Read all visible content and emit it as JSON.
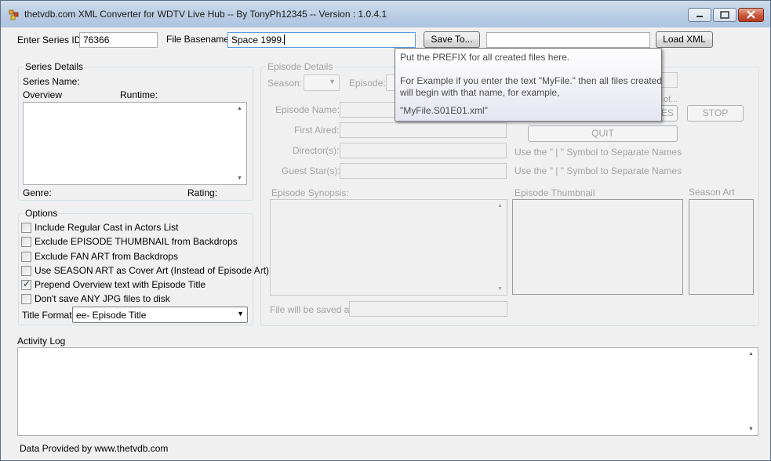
{
  "window": {
    "title": "thetvdb.com XML Converter for WDTV Live Hub -- By TonyPh12345 -- Version : 1.0.4.1"
  },
  "top": {
    "series_id_label": "Enter Series ID",
    "series_id_value": "76366",
    "basename_label": "File Basename",
    "basename_value": "Space 1999.",
    "save_to_label": "Save To...",
    "save_path_value": "",
    "load_xml_label": "Load XML"
  },
  "series_details": {
    "title": "Series Details",
    "name_label": "Series Name:",
    "overview_label": "Overview",
    "runtime_label": "Runtime:",
    "genre_label": "Genre:",
    "rating_label": "Rating:"
  },
  "options": {
    "title": "Options",
    "items": [
      {
        "label": "Include Regular Cast in Actors List",
        "checked": false
      },
      {
        "label": "Exclude EPISODE THUMBNAIL from Backdrops",
        "checked": false
      },
      {
        "label": "Exclude FAN ART from Backdrops",
        "checked": false
      },
      {
        "label": "Use SEASON ART as Cover Art (Instead of Episode Art)",
        "checked": false
      },
      {
        "label": "Prepend Overview text with Episode Title",
        "checked": true
      },
      {
        "label": "Don't save ANY JPG files to disk",
        "checked": false
      }
    ],
    "title_format_label": "Title Format :",
    "title_format_value": "ee- Episode Title"
  },
  "episode_details": {
    "title": "Episode Details",
    "season_label": "Season:",
    "episode_label": "Episode:",
    "episode_name_label": "Episode Name:",
    "first_aired_label": "First Aired:",
    "directors_label": "Director(s):",
    "guest_stars_label": "Guest Star(s):",
    "separator_hint": "Use the \" | \" Symbol to Separate Names",
    "synopsis_label": "Episode Synopsis:",
    "thumbnail_label": "Episode Thumbnail",
    "season_art_label": "Season Art",
    "saved_as_label": "File will be saved as:",
    "partial_hint": "of...",
    "partial_button": "ES",
    "stop_label": "STOP",
    "quit_label": "QUIT"
  },
  "tooltip": {
    "line1": "Put the PREFIX for all created files here.",
    "line2": "For Example if you enter the text \"MyFile.\" then all files created",
    "line3": "will begin with that name, for example,",
    "line4": "\"MyFile.S01E01.xml\""
  },
  "activity": {
    "label": "Activity Log",
    "content": ""
  },
  "footer": {
    "text": "Data Provided by www.thetvdb.com"
  }
}
